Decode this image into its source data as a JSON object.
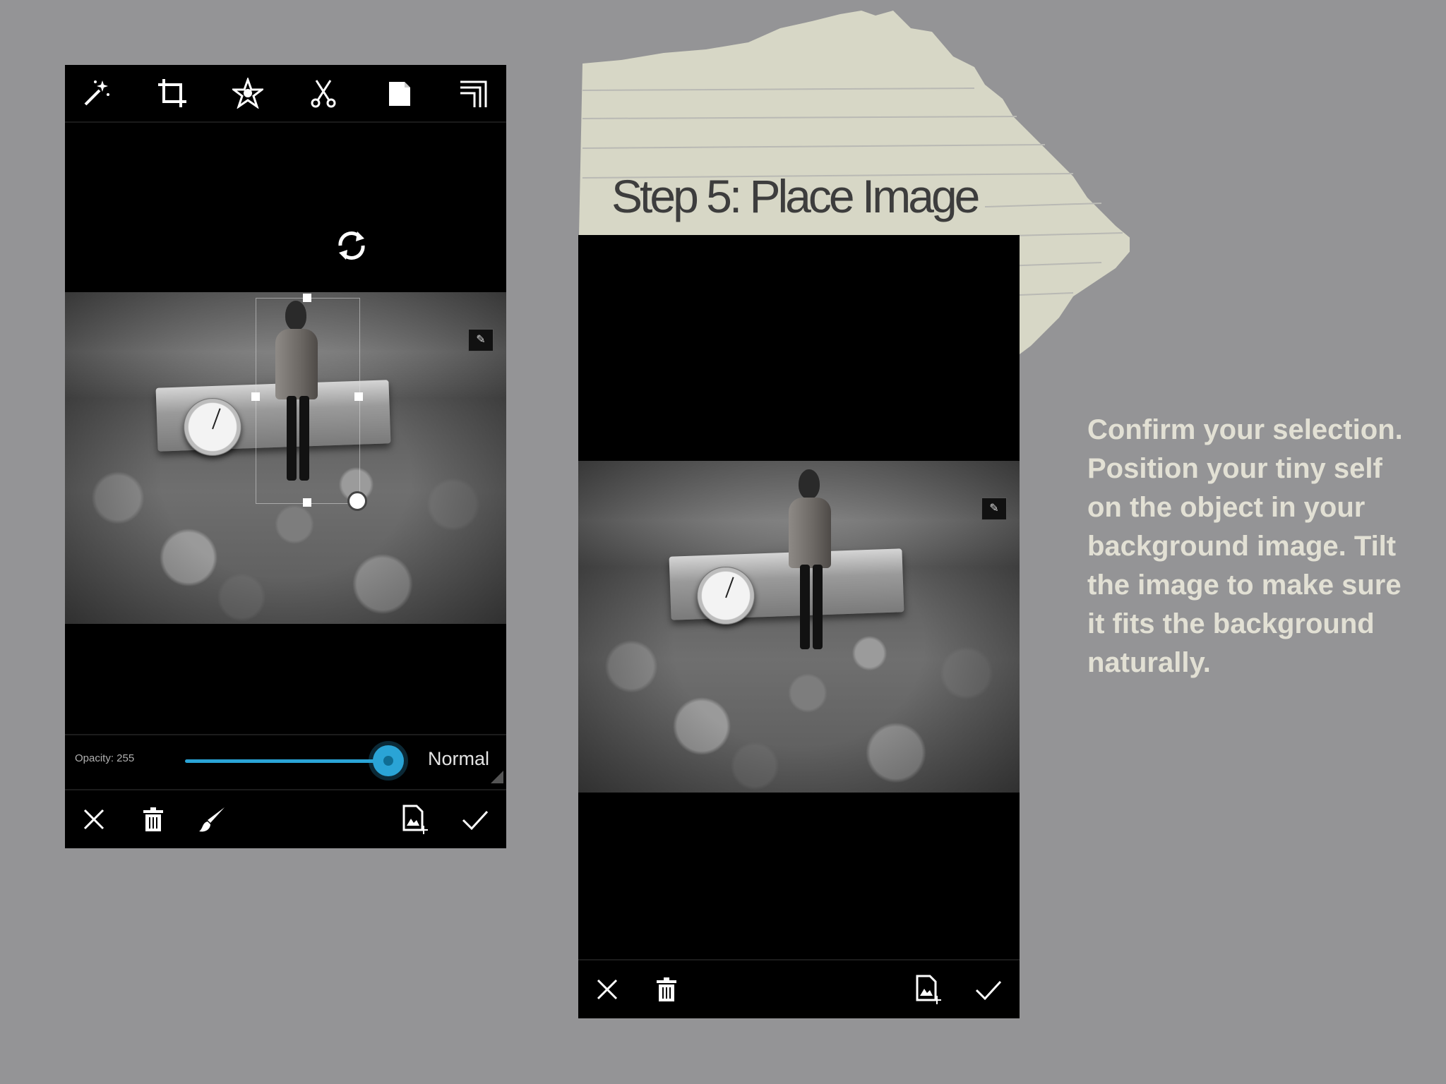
{
  "slide": {
    "step_title": "Step 5: Place Image",
    "instructions": "Confirm your selection. Position your tiny self on the object in your background image. Tilt the image to make sure it fits the background naturally."
  },
  "left_screen": {
    "toolbar_icons": [
      "magic-wand-icon",
      "crop-icon",
      "star-icon",
      "scissors-icon",
      "blank-page-icon",
      "corner-frame-icon"
    ],
    "opacity_label": "Opacity: 255",
    "opacity_value": 255,
    "blend_mode": "Normal",
    "bottom_icons": [
      "close-icon",
      "trash-icon",
      "brush-icon",
      "add-image-icon",
      "check-icon"
    ]
  },
  "right_screen": {
    "bottom_icons": [
      "close-icon",
      "trash-icon",
      "add-image-icon",
      "check-icon"
    ]
  },
  "colors": {
    "background": "#949496",
    "accent": "#2aa4d6",
    "instruction_text": "#e2e0d4",
    "title_text": "#3d3d3d"
  }
}
